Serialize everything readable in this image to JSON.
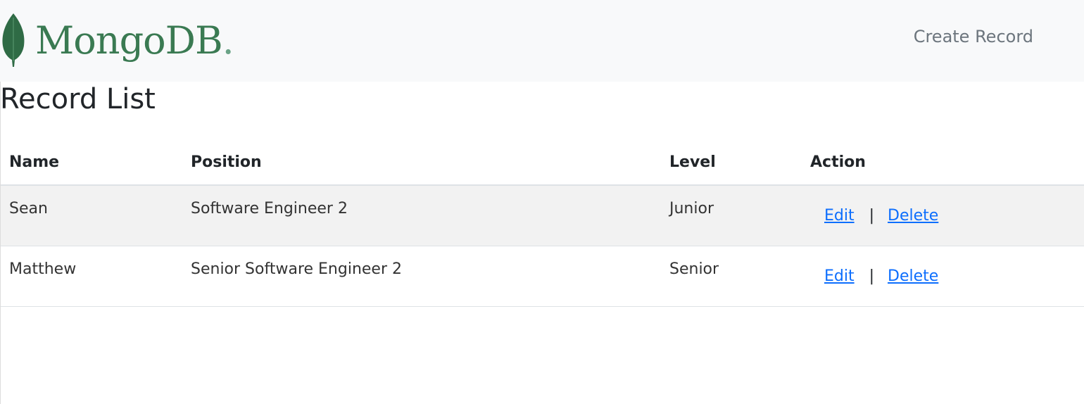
{
  "navbar": {
    "logo_text": "MongoDB",
    "logo_dot": ".",
    "create_record_label": "Create Record",
    "brand_color": "#3a7a52"
  },
  "page": {
    "title": "Record List"
  },
  "table": {
    "columns": [
      "Name",
      "Position",
      "Level",
      "Action"
    ],
    "rows": [
      {
        "name": "Sean",
        "position": "Software Engineer 2",
        "level": "Junior",
        "edit_label": "Edit",
        "separator": "|",
        "delete_label": "Delete"
      },
      {
        "name": "Matthew",
        "position": "Senior Software Engineer 2",
        "level": "Senior",
        "edit_label": "Edit",
        "separator": "|",
        "delete_label": "Delete"
      }
    ]
  },
  "colors": {
    "link": "#0d6efd",
    "nav_bg": "#f8f9fa",
    "row_stripe": "#f2f2f2"
  }
}
